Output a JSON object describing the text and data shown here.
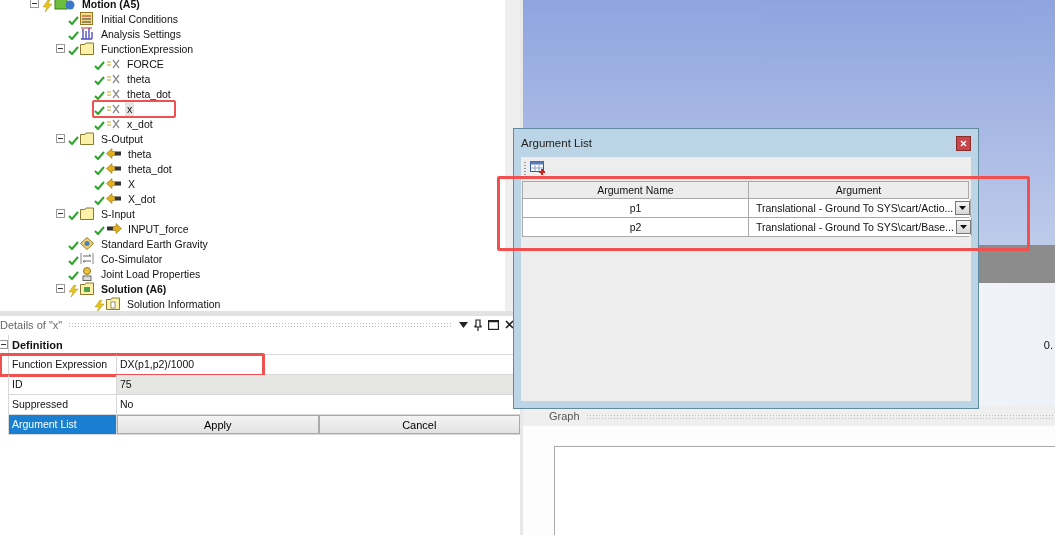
{
  "tree": [
    {
      "label": "Motion (A5)",
      "kind": "model",
      "solved": false,
      "expanded": true,
      "selected": false,
      "highlighted": false,
      "children": [
        {
          "label": "Initial Conditions",
          "kind": "conditions",
          "solved": true,
          "selected": false,
          "highlighted": false
        },
        {
          "label": "Analysis Settings",
          "kind": "settings",
          "solved": true,
          "selected": false,
          "highlighted": false
        },
        {
          "label": "FunctionExpression",
          "kind": "folder",
          "solved": true,
          "expanded": true,
          "selected": false,
          "highlighted": false,
          "children": [
            {
              "label": "FORCE",
              "kind": "function",
              "solved": true,
              "selected": false,
              "highlighted": false
            },
            {
              "label": "theta",
              "kind": "function",
              "solved": true,
              "selected": false,
              "highlighted": false
            },
            {
              "label": "theta_dot",
              "kind": "function",
              "solved": true,
              "selected": false,
              "highlighted": false
            },
            {
              "label": "x",
              "kind": "function",
              "solved": true,
              "selected": true,
              "highlighted": true
            },
            {
              "label": "x_dot",
              "kind": "function",
              "solved": true,
              "selected": false,
              "highlighted": false
            }
          ]
        },
        {
          "label": "S-Output",
          "kind": "folder",
          "solved": true,
          "expanded": true,
          "selected": false,
          "highlighted": false,
          "children": [
            {
              "label": "theta",
              "kind": "output",
              "solved": true,
              "selected": false,
              "highlighted": false
            },
            {
              "label": "theta_dot",
              "kind": "output",
              "solved": true,
              "selected": false,
              "highlighted": false
            },
            {
              "label": "X",
              "kind": "output",
              "solved": true,
              "selected": false,
              "highlighted": false
            },
            {
              "label": "X_dot",
              "kind": "output",
              "solved": true,
              "selected": false,
              "highlighted": false
            }
          ]
        },
        {
          "label": "S-Input",
          "kind": "folder",
          "solved": true,
          "expanded": true,
          "selected": false,
          "highlighted": false,
          "children": [
            {
              "label": "INPUT_force",
              "kind": "input",
              "solved": true,
              "selected": false,
              "highlighted": false
            }
          ]
        },
        {
          "label": "Standard Earth Gravity",
          "kind": "gravity",
          "solved": true,
          "selected": false,
          "highlighted": false
        },
        {
          "label": "Co-Simulator",
          "kind": "cosim",
          "solved": true,
          "selected": false,
          "highlighted": false
        },
        {
          "label": "Joint Load Properties",
          "kind": "jointload",
          "solved": true,
          "selected": false,
          "highlighted": false
        },
        {
          "label": "Solution (A6)",
          "kind": "solution",
          "solved": false,
          "expanded": true,
          "selected": false,
          "highlighted": false,
          "children": [
            {
              "label": "Solution Information",
              "kind": "info",
              "solved": false,
              "selected": false,
              "highlighted": false
            }
          ]
        }
      ]
    }
  ],
  "details": {
    "title": "Details of \"x\"",
    "rows": [
      {
        "kind": "section",
        "label": "Definition",
        "expanded": true
      },
      {
        "kind": "field",
        "label": "Function Expression",
        "value": "DX(p1,p2)/1000",
        "highlighted": true,
        "selected": false
      },
      {
        "kind": "readonly",
        "label": "ID",
        "value": "75",
        "highlighted": false,
        "selected": false
      },
      {
        "kind": "field",
        "label": "Suppressed",
        "value": "No",
        "highlighted": false,
        "selected": false
      },
      {
        "kind": "buttons",
        "label": "Argument List",
        "buttons": [
          "Apply",
          "Cancel"
        ],
        "highlighted": false,
        "selected": true
      }
    ]
  },
  "view": {
    "scale_label": "0."
  },
  "graph": {
    "title": "Graph"
  },
  "dialog": {
    "title": "Argument List",
    "highlighted": true,
    "columns": [
      "Argument Name",
      "Argument"
    ],
    "rows": [
      {
        "name": "p1",
        "argument": "Translational - Ground To SYS\\cart/Actio..."
      },
      {
        "name": "p2",
        "argument": "Translational - Ground To SYS\\cart/Base..."
      }
    ]
  }
}
